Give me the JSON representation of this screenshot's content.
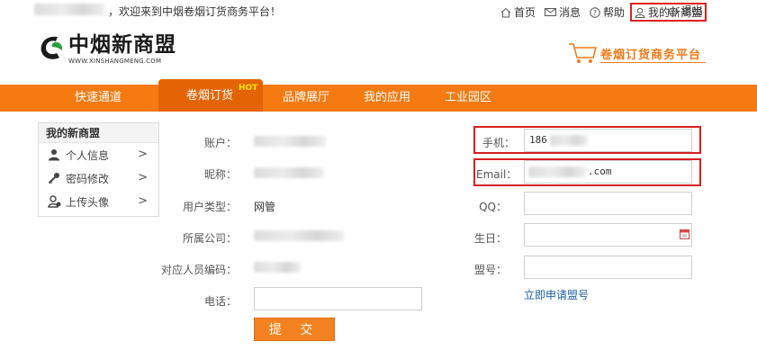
{
  "topbar": {
    "welcome": "，欢迎来到中烟卷烟订货商务平台！",
    "links": {
      "home": "首页",
      "messages": "消息",
      "help": "帮助",
      "my_union": "我的新商盟",
      "logout": "退出"
    }
  },
  "header": {
    "logo_name": "中烟新商盟",
    "logo_url": "WWW.XINSHANGMENG.COM",
    "platform": "卷烟订货商务平台"
  },
  "nav": {
    "items": [
      "快速通道",
      "卷烟订货",
      "品牌展厅",
      "我的应用",
      "工业园区"
    ],
    "badge": "HOT",
    "active_index": 1
  },
  "sidebar": {
    "title": "我的新商盟",
    "items": [
      {
        "label": "个人信息",
        "icon": "person-icon"
      },
      {
        "label": "密码修改",
        "icon": "key-icon"
      },
      {
        "label": "上传头像",
        "icon": "avatar-upload-icon"
      }
    ]
  },
  "form": {
    "account_label": "账户：",
    "nickname_label": "昵称：",
    "user_type_label": "用户类型：",
    "user_type_value": "网管",
    "company_label": "所属公司：",
    "staff_code_label": "对应人员编码：",
    "phone_label": "电话：",
    "mobile_label": "手机：",
    "mobile_value": "186",
    "email_label": "Email：",
    "email_value": ".com",
    "qq_label": "QQ：",
    "birthday_label": "生日：",
    "league_no_label": "盟号：",
    "apply_link": "立即申请盟号",
    "submit": "提 交"
  },
  "colors": {
    "nav": "#f47a11",
    "accent": "#f07a18",
    "highlight": "#d62020",
    "link": "#1f5fb0"
  }
}
